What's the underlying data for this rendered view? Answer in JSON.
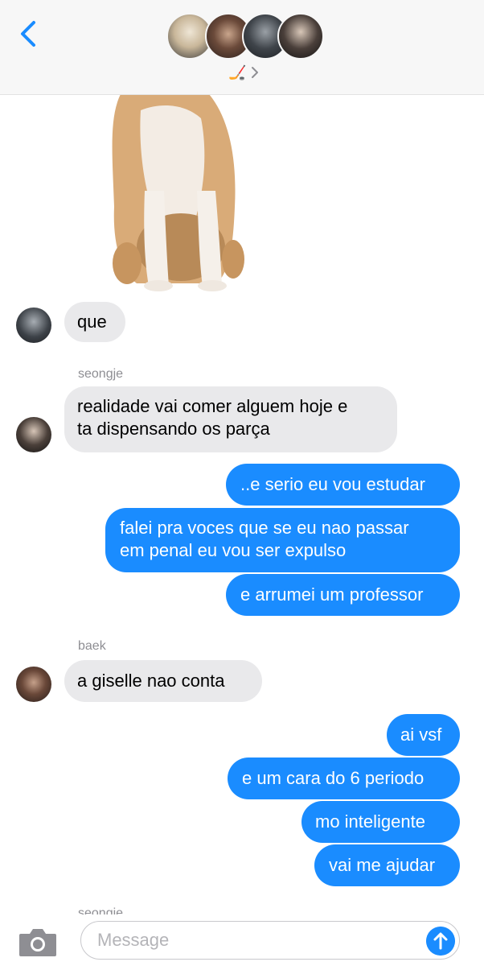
{
  "header": {
    "group_emoji": "🏒"
  },
  "messages": {
    "m1": "que",
    "sender2": "seongje",
    "m2_line1": "realidade vai comer alguem hoje e",
    "m2_line2": "ta dispensando os parça",
    "s1": "..e serio eu vou estudar",
    "s2_line1": "falei pra voces que se eu nao passar",
    "s2_line2": "em penal eu vou ser expulso",
    "s3": "e arrumei um professor",
    "sender3": "baek",
    "m3": "a giselle nao conta",
    "s4": "ai vsf",
    "s5": "e um cara do 6 periodo",
    "s6": "mo inteligente",
    "s7": "vai me ajudar",
    "sender4_partial": "seongje"
  },
  "input": {
    "placeholder": "Message"
  },
  "colors": {
    "sent_bubble": "#1a8cff",
    "received_bubble": "#e9e9eb",
    "accent": "#1a8cff"
  }
}
